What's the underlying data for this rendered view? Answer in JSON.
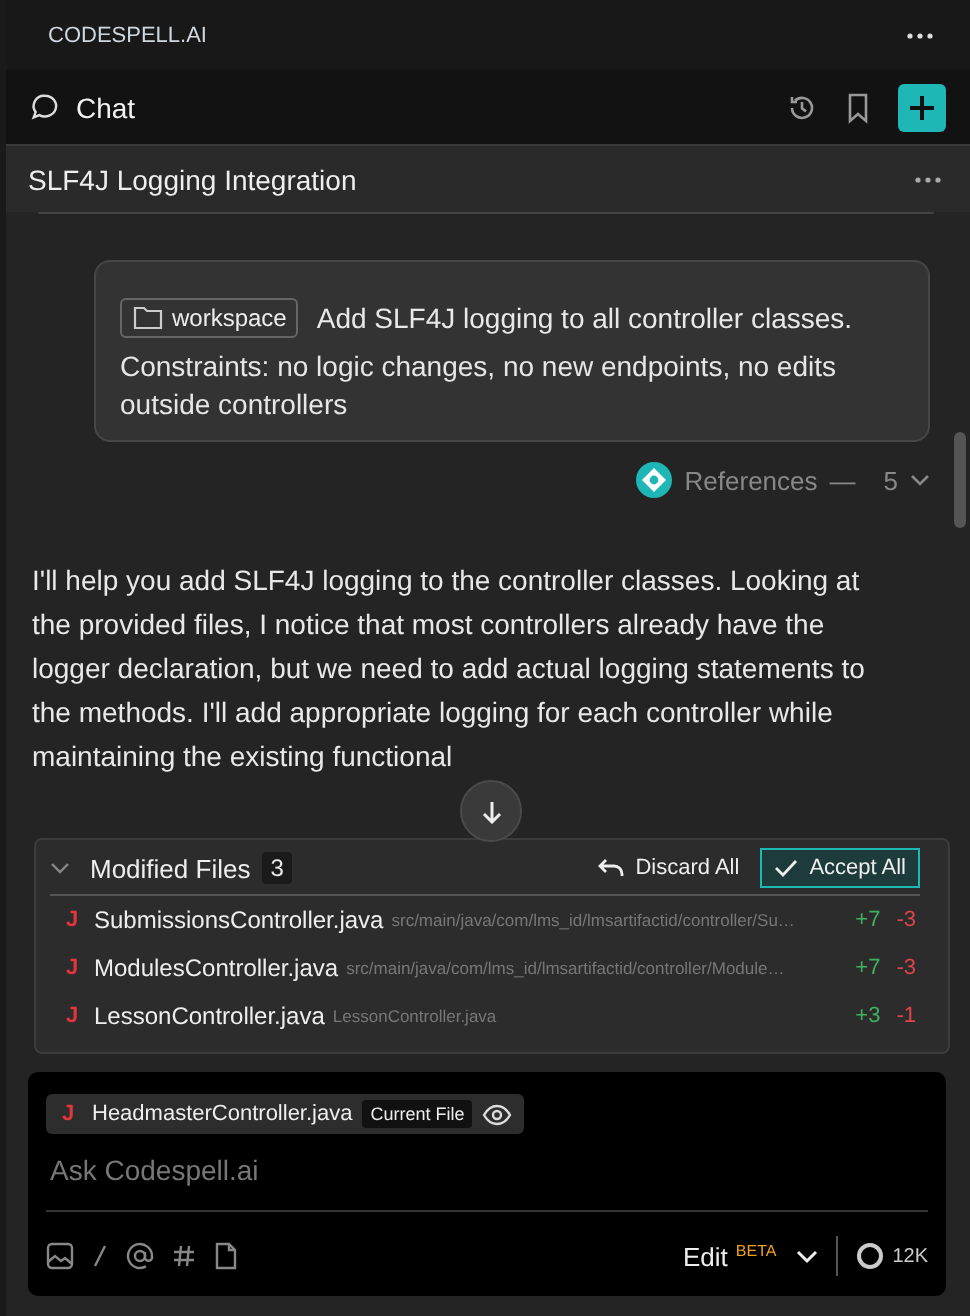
{
  "app_bar": {
    "brand": "CODESPELL.AI"
  },
  "chat_bar": {
    "title": "Chat"
  },
  "conversation": {
    "title": "SLF4J Logging Integration"
  },
  "user_message": {
    "context_chip": "workspace",
    "lines": [
      "Add SLF4J logging to all controller classes.",
      "Constraints: no logic changes, no new endpoints, no edits outside controllers"
    ]
  },
  "references": {
    "label": "References",
    "separator": "—",
    "count": "5",
    "expanded": false
  },
  "assistant_message": "I'll help you add SLF4J logging to the controller classes. Looking at the provided files, I notice that most controllers already have the logger declaration, but we need to add actual logging statements to the methods. I'll add appropriate logging for each controller while maintaining the existing functional",
  "modified_files": {
    "title": "Modified Files",
    "count": "3",
    "expanded": true,
    "discard_label": "Discard All",
    "accept_label": "Accept All",
    "files": [
      {
        "badge": "J",
        "name": "SubmissionsController.java",
        "path": "src/main/java/com/lms_id/lmsartifactid/controller/Su…",
        "added": "+7",
        "removed": "-3"
      },
      {
        "badge": "J",
        "name": "ModulesController.java",
        "path": "src/main/java/com/lms_id/lmsartifactid/controller/Module…",
        "added": "+7",
        "removed": "-3"
      },
      {
        "badge": "J",
        "name": "LessonController.java",
        "path": "LessonController.java",
        "added": "+3",
        "removed": "-1"
      }
    ]
  },
  "composer": {
    "file_chip": {
      "badge": "J",
      "name": "HeadmasterController.java",
      "tag": "Current File"
    },
    "placeholder": "Ask Codespell.ai",
    "mode": "Edit",
    "mode_tag": "BETA",
    "tokens": "12K"
  }
}
